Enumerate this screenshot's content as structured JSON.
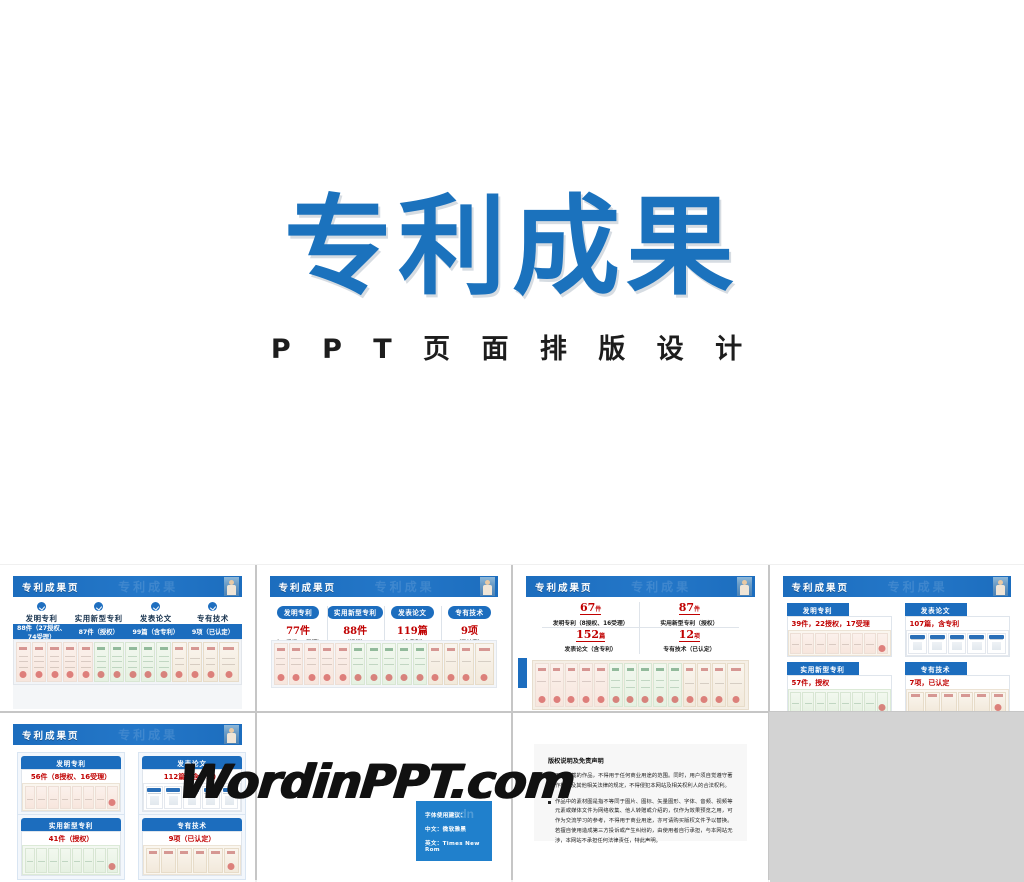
{
  "hero": {
    "title": "专利成果",
    "subtitle": "P P T 页 面 排 版 设 计"
  },
  "watermark": "WordinPPT.com",
  "slide_header_title": "专利成果页",
  "slide_header_ghost": "专利成果",
  "slides": [
    {
      "id": "slide-1",
      "columns": [
        {
          "label": "发明专利",
          "stat": "88件（27授权、74受理）"
        },
        {
          "label": "实用新型专利",
          "stat": "87件（授权）"
        },
        {
          "label": "发表论文",
          "stat": "99篇（含专利）"
        },
        {
          "label": "专有技术",
          "stat": "9项（已认定）"
        }
      ]
    },
    {
      "id": "slide-2",
      "columns": [
        {
          "label": "发明专利",
          "number": "77件",
          "note": "（26授权,71受理）"
        },
        {
          "label": "实用新型专利",
          "number": "88件",
          "note": "（授权）"
        },
        {
          "label": "发表论文",
          "number": "119篇",
          "note": "（含专利）"
        },
        {
          "label": "专有技术",
          "number": "9项",
          "note": "（已认定）"
        }
      ]
    },
    {
      "id": "slide-3",
      "cells": [
        {
          "number": "67",
          "unit": "件",
          "label": "发明专利（8授权、16受理）"
        },
        {
          "number": "87",
          "unit": "件",
          "label": "实用新型专利（授权）"
        },
        {
          "number": "152",
          "unit": "篇",
          "label": "发表论文（含专利）"
        },
        {
          "number": "12",
          "unit": "项",
          "label": "专有技术（已认定）"
        }
      ]
    },
    {
      "id": "slide-4",
      "cards": [
        {
          "label": "发明专利",
          "stat": "39件，22授权，17受理"
        },
        {
          "label": "发表论文",
          "stat": "107篇，含专利"
        },
        {
          "label": "实用新型专利",
          "stat": "57件，授权"
        },
        {
          "label": "专有技术",
          "stat": "7项，已认定"
        }
      ]
    },
    {
      "id": "slide-5",
      "cards": [
        {
          "label": "发明专利",
          "stat": "56件（8授权、16受理）"
        },
        {
          "label": "发表论文",
          "stat": "112篇（含专利）"
        },
        {
          "label": "实用新型专利",
          "stat": "41件（授权）"
        },
        {
          "label": "专有技术",
          "stat": "9项（已认定）"
        }
      ]
    },
    {
      "id": "slide-6",
      "font_note": {
        "title": "字体使用建议：",
        "chinese": "中文：微软雅黑",
        "english": "英文：Times New Rom"
      },
      "ghost": "csdn"
    },
    {
      "id": "slide-7",
      "copyright": {
        "title": "版权说明及免责声明",
        "paragraphs": [
          "用户下载的作品，不得用于任何商业用途的范围。同时，用户须自觉遵守著作权法及其他相关法律的规定，不得侵犯本网站及相关权利人的合法权利。",
          "作品中的素材图是指不等同于图片、图标、矢量图形、字体、音频、视频等元素或媒体文件为网络收集、他人转赠或介绍的，仅作为效果预览之用，可作为交流学习的参考，不得用于商业用途，亦可请购买版权文件予以替换。若擅自使用造成第三方投诉或产生纠纷的，由使用者自行承担，与本网站无涉，本网站不承担任何法律责任，特此声明。"
        ]
      }
    }
  ],
  "colors": {
    "brand_blue": "#1c6dbe",
    "title_blue": "#1b72bd",
    "stat_red": "#c00000",
    "grid_bg": "#d3d3d3"
  }
}
